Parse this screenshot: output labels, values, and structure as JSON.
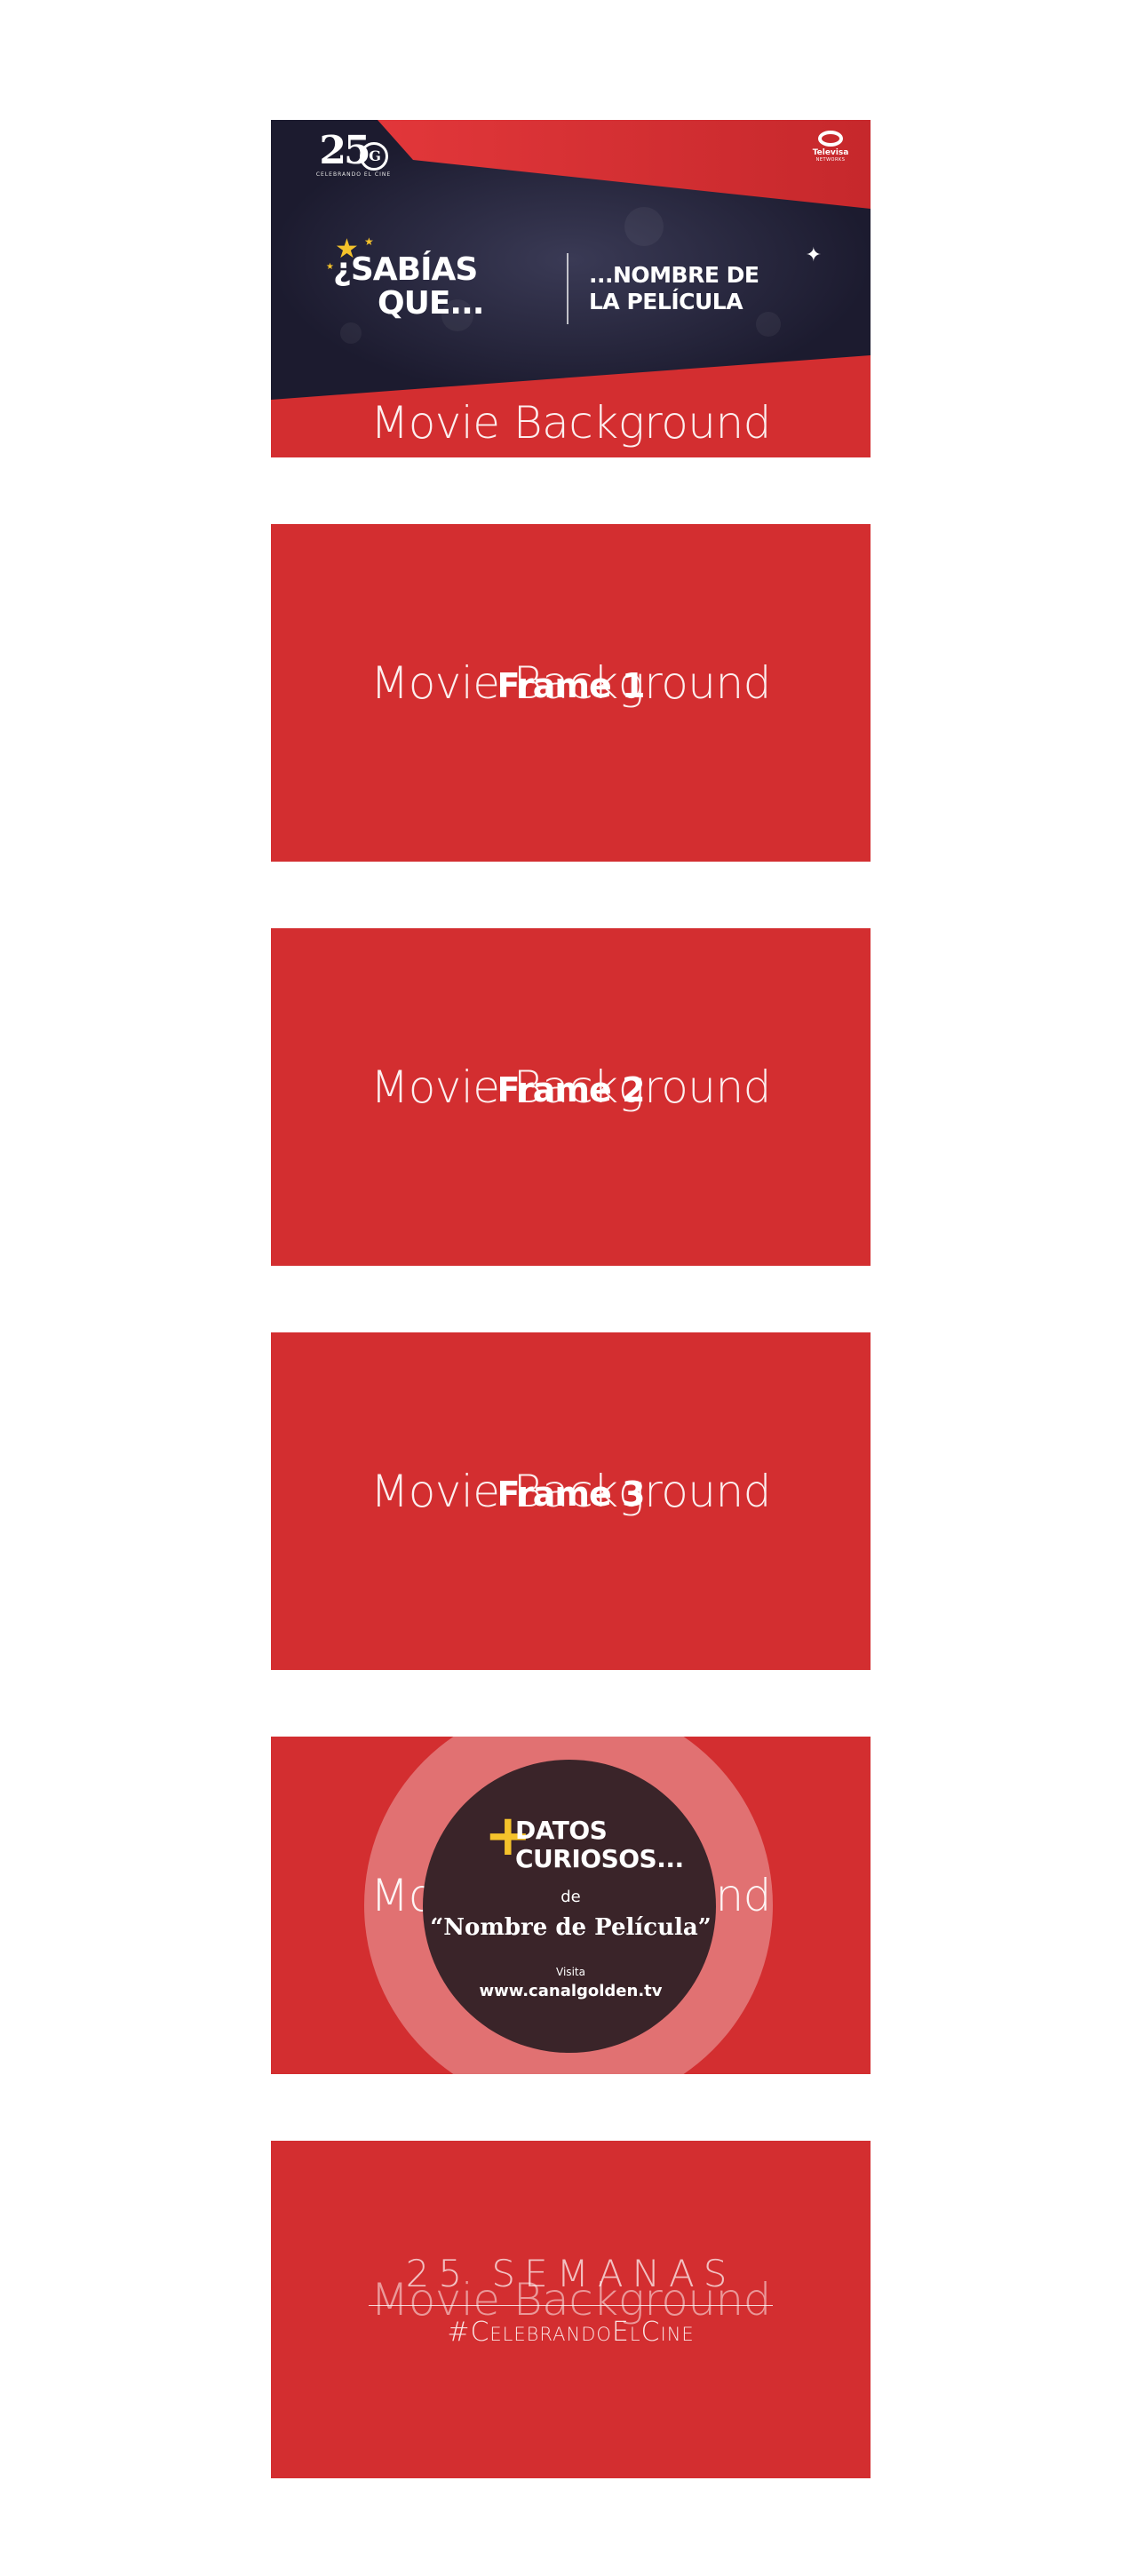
{
  "common": {
    "background_text": "Movie Background"
  },
  "intro": {
    "logo_number": "25",
    "logo_letter": "G",
    "logo_tagline": "CELEBRANDO EL CINE",
    "network_name": "Televisa",
    "network_sub": "NETWORKS",
    "headline_line1": "¿SABÍAS",
    "headline_line2": "QUE...",
    "movie_title_line1": "...NOMBRE DE",
    "movie_title_line2": "LA PELÍCULA"
  },
  "frames": [
    {
      "label": "Frame 1"
    },
    {
      "label": "Frame 2"
    },
    {
      "label": "Frame 3"
    }
  ],
  "datos": {
    "plus": "+",
    "title_line1": "DATOS",
    "title_line2": "CURIOSOS...",
    "de": "de",
    "movie_name": "“Nombre de Película”",
    "visit_label": "Visita",
    "url": "www.canalgolden.tv"
  },
  "closing": {
    "weeks": "25 SEMANAS",
    "hashtag": "#CelebrandoElCine"
  },
  "colors": {
    "red": "#d32e30",
    "navy": "#23213a",
    "gold": "#f4c22b",
    "circle": "#3a2429"
  }
}
